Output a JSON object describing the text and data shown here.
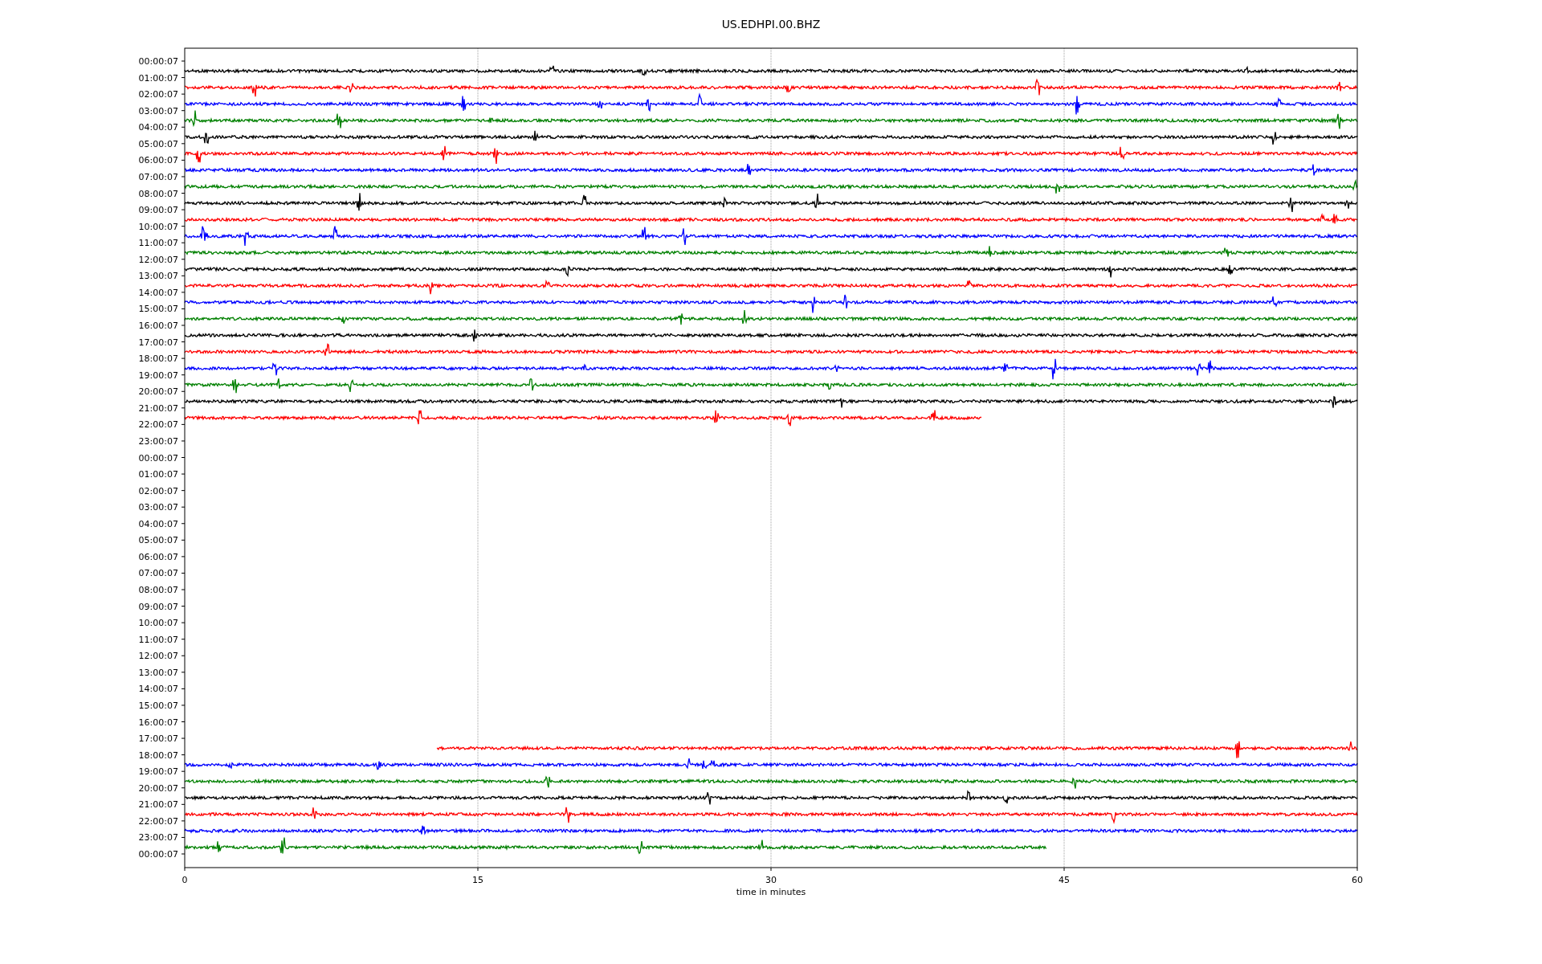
{
  "title": "US.EDHPI.00.BHZ",
  "rows": [
    {
      "label": "00:00:07",
      "trace": {
        "color": "#000000",
        "level": 1,
        "kind": "from-left"
      }
    },
    {
      "label": "01:00:07",
      "trace": {
        "color": "#ff0000",
        "level": 1,
        "kind": "from-left"
      }
    },
    {
      "label": "02:00:07",
      "trace": {
        "color": "#0000ff",
        "level": 1,
        "kind": "from-left"
      }
    },
    {
      "label": "03:00:07",
      "trace": {
        "color": "#008000",
        "level": 1,
        "kind": "from-left"
      }
    },
    {
      "label": "04:00:07",
      "trace": {
        "color": "#000000",
        "level": 1,
        "kind": "from-left"
      }
    },
    {
      "label": "05:00:07",
      "trace": {
        "color": "#ff0000",
        "level": 1,
        "kind": "from-left"
      }
    },
    {
      "label": "06:00:07",
      "trace": {
        "color": "#0000ff",
        "level": 1,
        "kind": "from-left"
      }
    },
    {
      "label": "07:00:07",
      "trace": {
        "color": "#008000",
        "level": 1,
        "kind": "from-left"
      }
    },
    {
      "label": "08:00:07",
      "trace": {
        "color": "#000000",
        "level": 1,
        "kind": "from-left"
      }
    },
    {
      "label": "09:00:07",
      "trace": {
        "color": "#ff0000",
        "level": 1,
        "kind": "from-left"
      }
    },
    {
      "label": "10:00:07",
      "trace": {
        "color": "#0000ff",
        "level": 1,
        "kind": "from-left"
      }
    },
    {
      "label": "11:00:07",
      "trace": {
        "color": "#008000",
        "level": 1,
        "kind": "from-left"
      }
    },
    {
      "label": "12:00:07",
      "trace": {
        "color": "#000000",
        "level": 1,
        "kind": "from-left"
      }
    },
    {
      "label": "13:00:07",
      "trace": {
        "color": "#ff0000",
        "level": 1,
        "kind": "from-left"
      }
    },
    {
      "label": "14:00:07",
      "trace": {
        "color": "#0000ff",
        "level": 1,
        "kind": "from-left"
      }
    },
    {
      "label": "15:00:07",
      "trace": {
        "color": "#008000",
        "level": 1,
        "kind": "from-left"
      }
    },
    {
      "label": "16:00:07",
      "trace": {
        "color": "#000000",
        "level": 1,
        "kind": "from-left"
      }
    },
    {
      "label": "17:00:07",
      "trace": {
        "color": "#ff0000",
        "level": 1,
        "kind": "from-left"
      }
    },
    {
      "label": "18:00:07",
      "trace": {
        "color": "#0000ff",
        "level": 1,
        "kind": "from-left"
      }
    },
    {
      "label": "19:00:07",
      "trace": {
        "color": "#008000",
        "level": 1,
        "kind": "from-left"
      }
    },
    {
      "label": "20:00:07",
      "trace": {
        "color": "#000000",
        "level": 1,
        "kind": "from-left"
      }
    },
    {
      "label": "21:00:07",
      "trace": {
        "color": "#ff0000",
        "level": 0.68,
        "kind": "from-left"
      }
    },
    {
      "label": "22:00:07"
    },
    {
      "label": "23:00:07"
    },
    {
      "label": "00:00:07"
    },
    {
      "label": "01:00:07"
    },
    {
      "label": "02:00:07"
    },
    {
      "label": "03:00:07"
    },
    {
      "label": "04:00:07"
    },
    {
      "label": "05:00:07"
    },
    {
      "label": "06:00:07"
    },
    {
      "label": "07:00:07"
    },
    {
      "label": "08:00:07"
    },
    {
      "label": "09:00:07"
    },
    {
      "label": "10:00:07"
    },
    {
      "label": "11:00:07"
    },
    {
      "label": "12:00:07"
    },
    {
      "label": "13:00:07"
    },
    {
      "label": "14:00:07"
    },
    {
      "label": "15:00:07"
    },
    {
      "label": "16:00:07"
    },
    {
      "label": "17:00:07",
      "trace": {
        "color": "#ff0000",
        "level": 0.785,
        "kind": "from-right"
      }
    },
    {
      "label": "18:00:07",
      "trace": {
        "color": "#0000ff",
        "level": 1,
        "kind": "from-left"
      }
    },
    {
      "label": "19:00:07",
      "trace": {
        "color": "#008000",
        "level": 1,
        "kind": "from-left"
      }
    },
    {
      "label": "20:00:07",
      "trace": {
        "color": "#000000",
        "level": 1,
        "kind": "from-left"
      }
    },
    {
      "label": "21:00:07",
      "trace": {
        "color": "#ff0000",
        "level": 1,
        "kind": "from-left"
      }
    },
    {
      "label": "22:00:07",
      "trace": {
        "color": "#0000ff",
        "level": 1,
        "kind": "from-left"
      }
    },
    {
      "label": "23:00:07",
      "trace": {
        "color": "#008000",
        "level": 0.735,
        "kind": "from-left"
      }
    },
    {
      "label": "00:00:07"
    }
  ],
  "x_tick_labels": [
    "0",
    "15",
    "30",
    "45",
    "60"
  ],
  "x_axis_label": "time in minutes"
}
